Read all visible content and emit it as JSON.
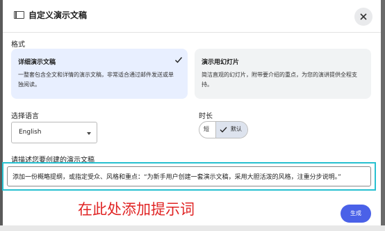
{
  "dialog": {
    "title": "自定义演示文稿",
    "close_icon": "close-icon",
    "title_icon": "presentation-icon"
  },
  "format": {
    "label": "格式",
    "options": [
      {
        "title": "详细演示文稿",
        "description": "一整套包含全文和详情的演示文稿，非常适合通过邮件发送或单独阅读。",
        "selected": true
      },
      {
        "title": "演示用幻灯片",
        "description": "简洁直观的幻灯片，附带要介绍的重点，为您的演讲提供全程支持。",
        "selected": false
      }
    ]
  },
  "language": {
    "label": "选择语言",
    "value": "English"
  },
  "length": {
    "label": "时长",
    "options": [
      "短",
      "默认"
    ],
    "selected": "默认"
  },
  "prompt": {
    "label": "请描述您要创建的演示文稿",
    "value": "添加一份概略提纲，或指定受众、风格和重点：“为新手用户创建一套演示文稿，采用大胆活泼的风格，注重分步说明。”"
  },
  "annotation": "在此处添加提示词",
  "actions": {
    "generate": "生成"
  },
  "colors": {
    "accent": "#4a61e8",
    "selected_card": "#e8efff",
    "highlight_border": "#27c0d0",
    "annotation": "#e02424"
  }
}
